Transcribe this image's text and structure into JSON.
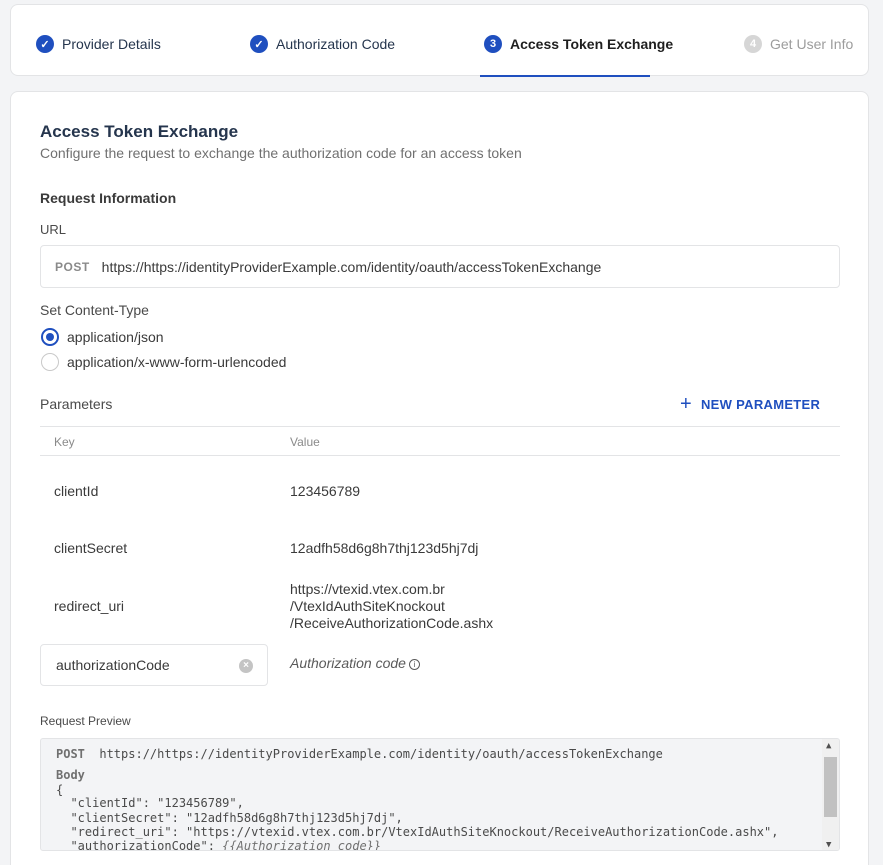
{
  "stepper": {
    "steps": [
      {
        "num": "✓",
        "label": "Provider Details"
      },
      {
        "num": "✓",
        "label": "Authorization Code"
      },
      {
        "num": "3",
        "label": "Access Token Exchange"
      },
      {
        "num": "4",
        "label": "Get User Info"
      }
    ]
  },
  "form": {
    "title": "Access Token Exchange",
    "subtitle": "Configure the request to exchange the authorization code for an access token",
    "request_info_title": "Request Information",
    "url_label": "URL",
    "url_method": "POST",
    "url_value": "https://https://identityProviderExample.com/identity/oauth/accessTokenExchange",
    "content_type_label": "Set Content-Type",
    "content_types": [
      {
        "label": "application/json",
        "checked": true
      },
      {
        "label": "application/x-www-form-urlencoded",
        "checked": false
      }
    ],
    "parameters_label": "Parameters",
    "new_parameter_label": "NEW PARAMETER",
    "table_headers": {
      "key": "Key",
      "value": "Value"
    },
    "rows": [
      {
        "key": "clientId",
        "value": "123456789"
      },
      {
        "key": "clientSecret",
        "value": "12adfh58d6g8h7thj123d5hj7dj"
      },
      {
        "key": "redirect_uri",
        "value_lines": [
          "https://vtexid.vtex.com.br",
          "/VtexIdAuthSiteKnockout",
          "/ReceiveAuthorizationCode.ashx"
        ]
      }
    ],
    "edit_row": {
      "key_input": "authorizationCode",
      "value_placeholder": "Authorization code"
    },
    "preview_label": "Request Preview",
    "preview": {
      "method": "POST",
      "url": "https://https://identityProviderExample.com/identity/oauth/accessTokenExchange",
      "body_label": "Body",
      "open_brace": "{",
      "line1": "  \"clientId\": \"123456789\",",
      "line2": "  \"clientSecret\": \"12adfh58d6g8h7thj123d5hj7dj\",",
      "line3": "  \"redirect_uri\": \"https://vtexid.vtex.com.br/VtexIdAuthSiteKnockout/ReceiveAuthorizationCode.ashx\",",
      "line4_key": "  \"authorizationCode\": ",
      "line4_value": "{{Authorization code}}"
    }
  }
}
